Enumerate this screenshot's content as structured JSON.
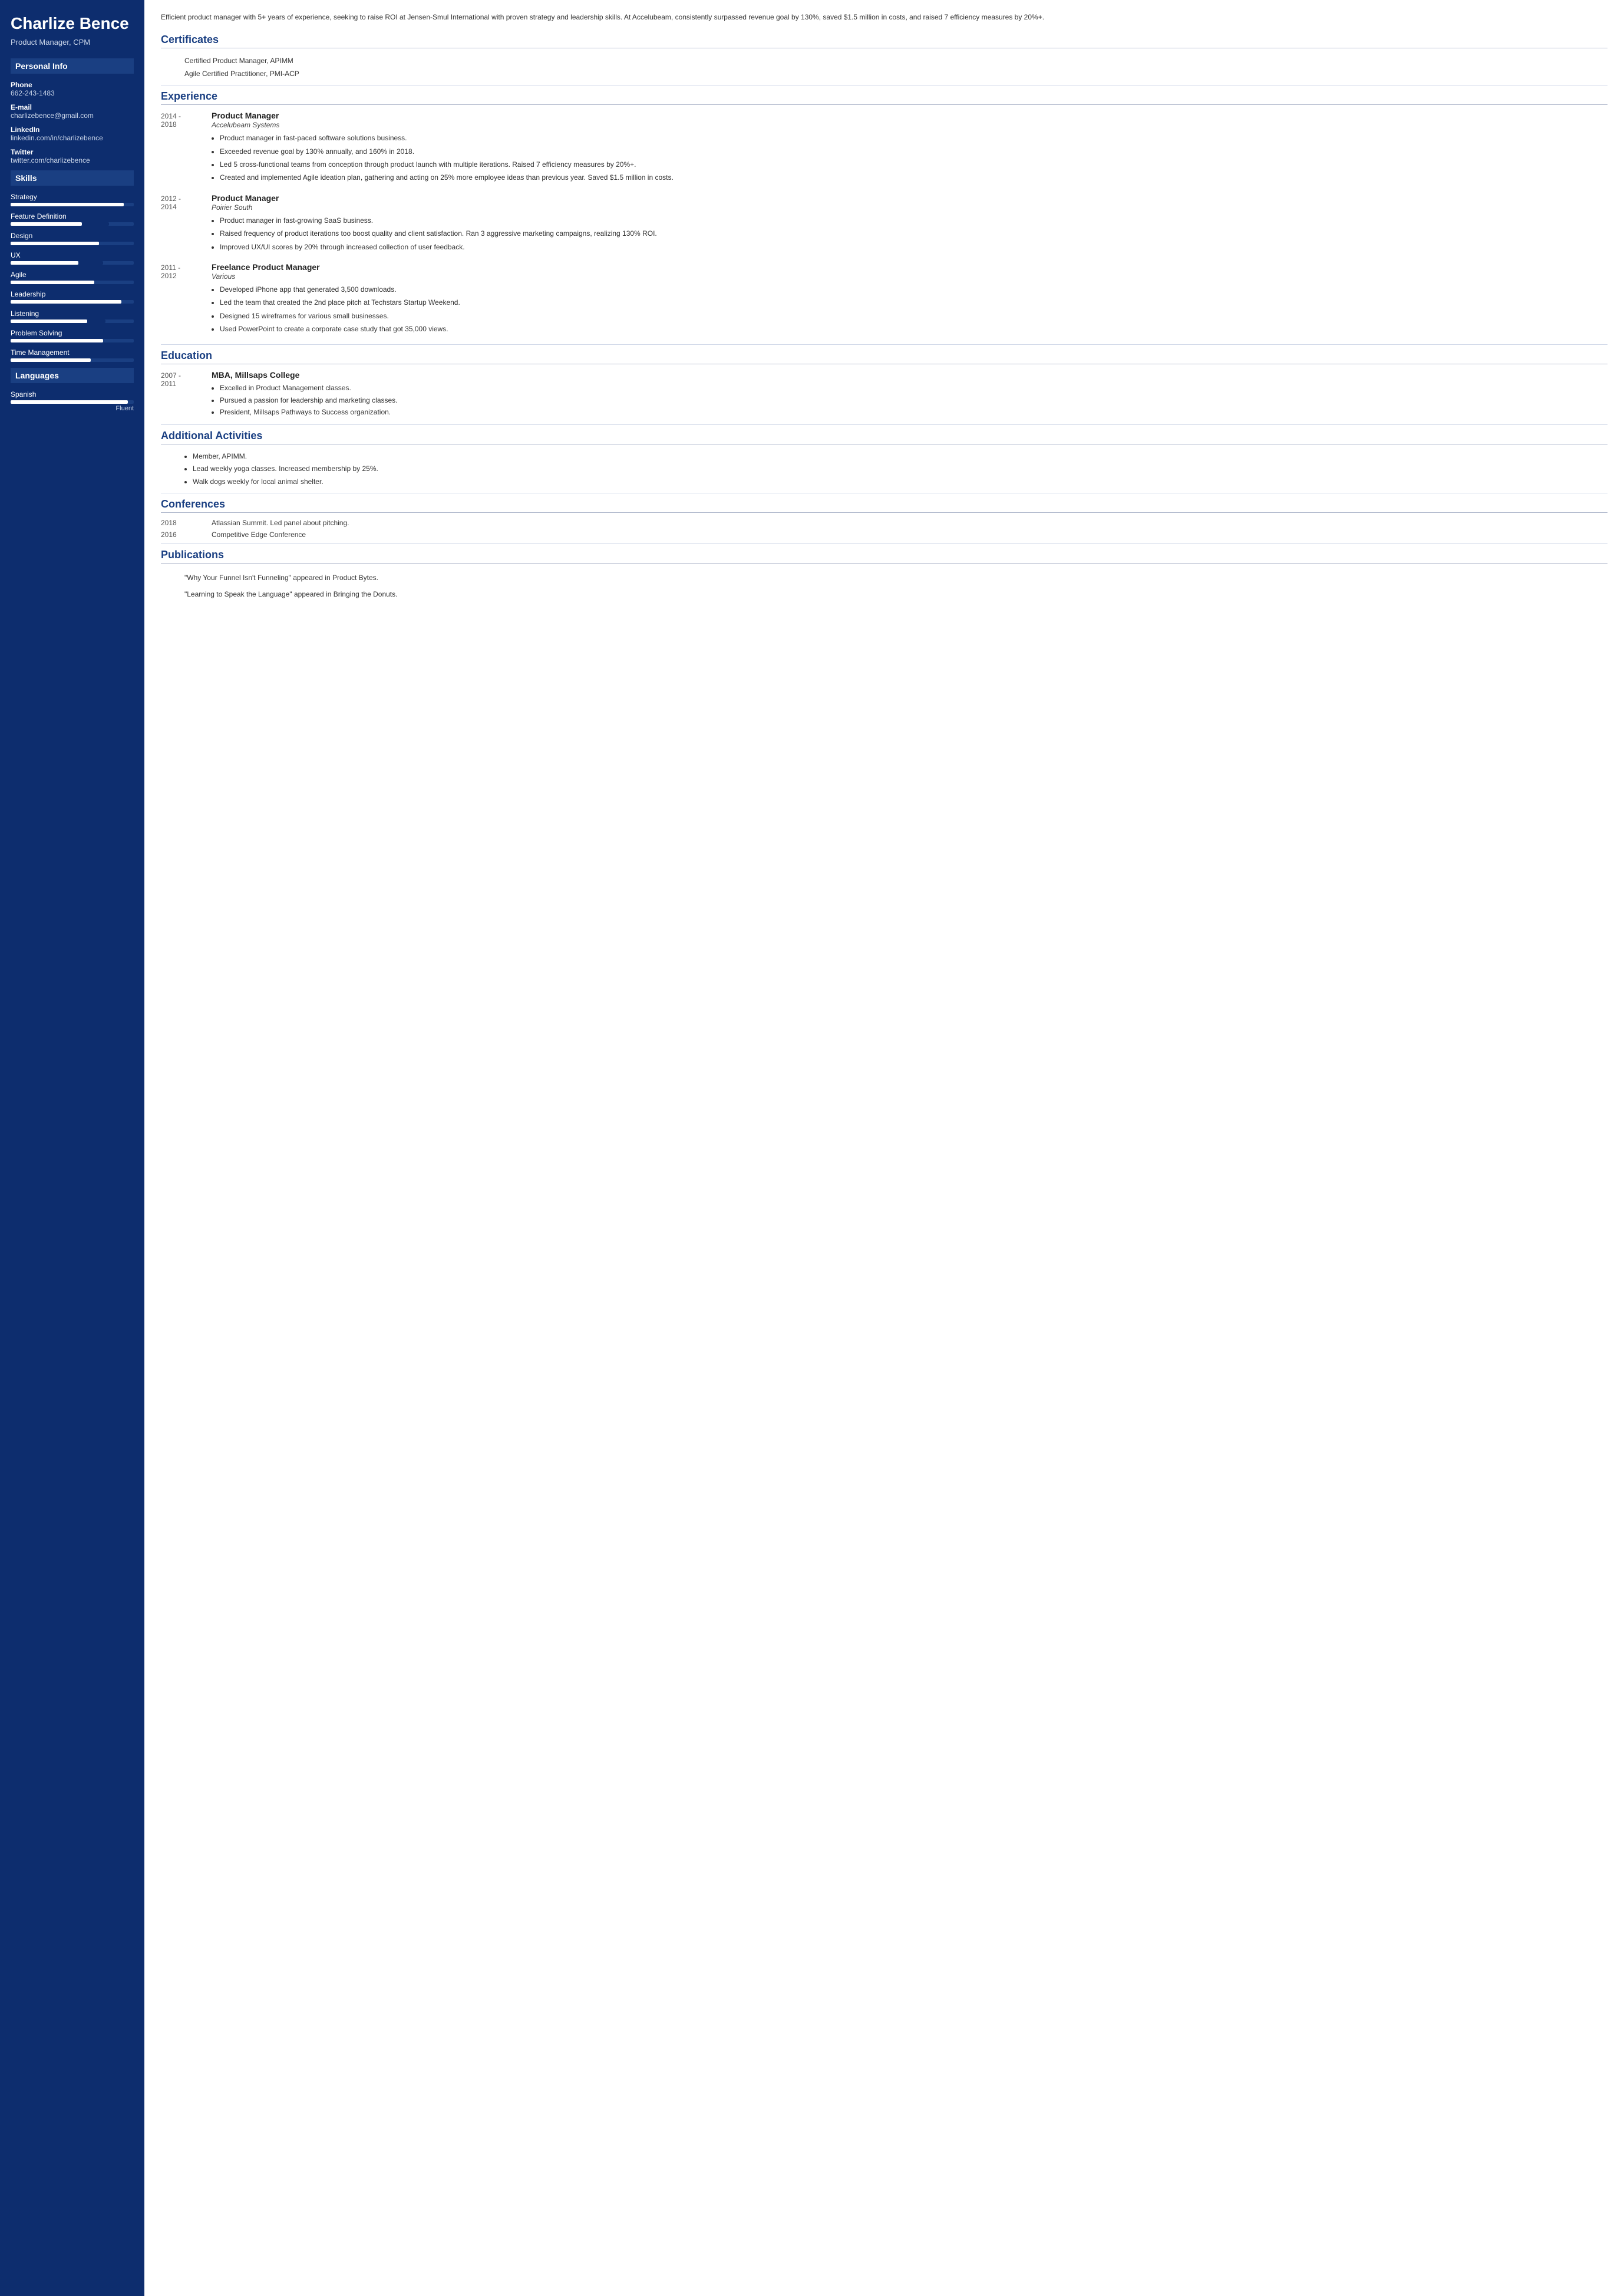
{
  "sidebar": {
    "name": "Charlize Bence",
    "title": "Product Manager, CPM",
    "personal_info_label": "Personal Info",
    "phone_label": "Phone",
    "phone_value": "662-243-1483",
    "email_label": "E-mail",
    "email_value": "charlizebence@gmail.com",
    "linkedin_label": "LinkedIn",
    "linkedin_value": "linkedin.com/in/charlizebence",
    "twitter_label": "Twitter",
    "twitter_value": "twitter.com/charlizebence",
    "skills_label": "Skills",
    "skills": [
      {
        "name": "Strategy",
        "fill_pct": 92,
        "extra": false
      },
      {
        "name": "Feature Definition",
        "fill_pct": 58,
        "extra_start": 58,
        "extra_width": 22,
        "has_extra": true
      },
      {
        "name": "Design",
        "fill_pct": 72,
        "has_extra": false
      },
      {
        "name": "UX",
        "fill_pct": 55,
        "extra_start": 55,
        "extra_width": 20,
        "has_extra": true
      },
      {
        "name": "Agile",
        "fill_pct": 68,
        "has_extra": false
      },
      {
        "name": "Leadership",
        "fill_pct": 90,
        "has_extra": false
      },
      {
        "name": "Listening",
        "fill_pct": 62,
        "extra_start": 62,
        "extra_width": 15,
        "has_extra": true
      },
      {
        "name": "Problem Solving",
        "fill_pct": 75,
        "has_extra": false
      },
      {
        "name": "Time Management",
        "fill_pct": 65,
        "has_extra": false
      }
    ],
    "languages_label": "Languages",
    "languages": [
      {
        "name": "Spanish",
        "fill_pct": 95,
        "level": "Fluent"
      }
    ]
  },
  "main": {
    "summary": "Efficient product manager with 5+ years of experience, seeking to raise ROI at Jensen-Smul International with proven strategy and leadership skills. At Accelubeam, consistently surpassed revenue goal by 130%, saved $1.5 million in costs, and raised 7 efficiency measures by 20%+.",
    "certificates_label": "Certificates",
    "certificates": [
      "Certified Product Manager, APIMM",
      "Agile Certified Practitioner, PMI-ACP"
    ],
    "experience_label": "Experience",
    "experience": [
      {
        "start": "2014 -",
        "end": "2018",
        "title": "Product Manager",
        "company": "Accelubeam Systems",
        "bullets": [
          "Product manager in fast-paced software solutions business.",
          "Exceeded revenue goal by 130% annually, and 160% in 2018.",
          "Led 5 cross-functional teams from conception through product launch with multiple iterations. Raised 7 efficiency measures by 20%+.",
          "Created and implemented Agile ideation plan, gathering and acting on 25% more employee ideas than previous year. Saved $1.5 million in costs."
        ]
      },
      {
        "start": "2012 -",
        "end": "2014",
        "title": "Product Manager",
        "company": "Poirier South",
        "bullets": [
          "Product manager in fast-growing SaaS business.",
          "Raised frequency of product iterations too boost quality and client satisfaction. Ran 3 aggressive marketing campaigns, realizing 130% ROI.",
          "Improved UX/UI scores by 20% through increased collection of user feedback."
        ]
      },
      {
        "start": "2011 -",
        "end": "2012",
        "title": "Freelance Product Manager",
        "company": "Various",
        "bullets": [
          "Developed iPhone app that generated 3,500 downloads.",
          "Led the team that created the 2nd place pitch at Techstars Startup Weekend.",
          "Designed 15 wireframes for various small businesses.",
          "Used PowerPoint to create a corporate case study that got 35,000 views."
        ]
      }
    ],
    "education_label": "Education",
    "education": [
      {
        "start": "2007 -",
        "end": "2011",
        "degree": "MBA, Millsaps College",
        "bullets": [
          "Excelled in Product Management classes.",
          "Pursued a passion for leadership and marketing classes.",
          "President, Millsaps Pathways to Success organization."
        ]
      }
    ],
    "activities_label": "Additional Activities",
    "activities": [
      "Member, APIMM.",
      "Lead weekly yoga classes. Increased membership by 25%.",
      "Walk dogs weekly for local animal shelter."
    ],
    "conferences_label": "Conferences",
    "conferences": [
      {
        "year": "2018",
        "text": "Atlassian Summit. Led panel about pitching."
      },
      {
        "year": "2016",
        "text": "Competitive Edge Conference"
      }
    ],
    "publications_label": "Publications",
    "publications": [
      "\"Why Your Funnel Isn't Funneling\" appeared in Product Bytes.",
      "\"Learning to Speak the Language\" appeared in Bringing the Donuts."
    ]
  }
}
